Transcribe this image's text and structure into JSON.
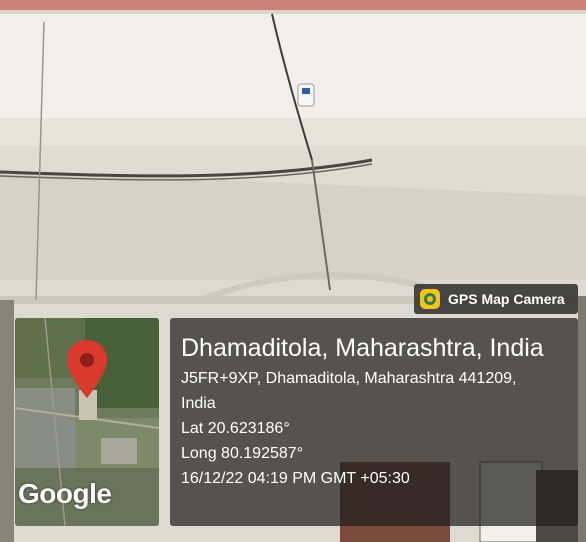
{
  "badge": {
    "app_name": "GPS Map Camera",
    "icon": "gps-map-camera-icon"
  },
  "map": {
    "attribution": "Google",
    "marker_icon": "location-pin-icon"
  },
  "location": {
    "title": "Dhamaditola, Maharashtra, India",
    "address_line1": "J5FR+9XP, Dhamaditola, Maharashtra 441209,",
    "address_line2": "India",
    "latitude": "Lat 20.623186°",
    "longitude": "Long 80.192587°",
    "timestamp": "16/12/22 04:19 PM GMT +05:30"
  },
  "colors": {
    "overlay": "#262626",
    "badge_icon": "#f3c21b",
    "pin": "#d93a2b",
    "text": "#ffffff"
  }
}
